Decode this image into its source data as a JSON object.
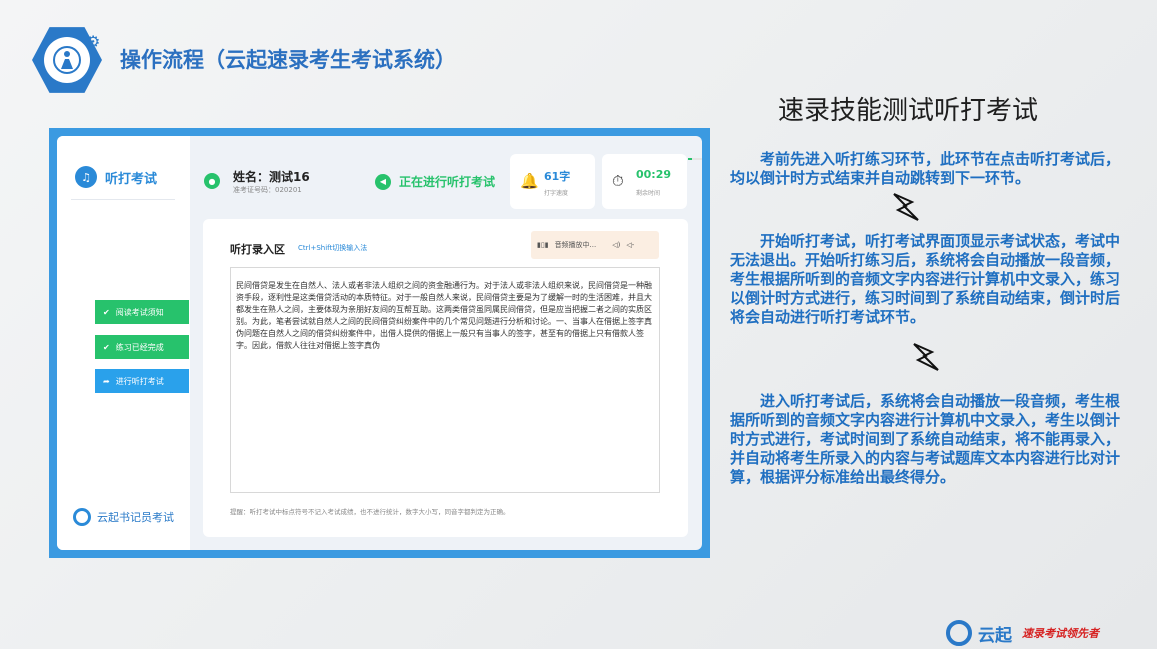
{
  "header": {
    "title": "操作流程（云起速录考生考试系统）"
  },
  "section": {
    "title": "速录技能测试听打考试",
    "paragraphs": [
      "　　考前先进入听打练习环节，此环节在点击听打考试后，均以倒计时方式结束并自动跳转到下一环节。",
      "　　开始听打考试，听打考试界面顶显示考试状态，考试中无法退出。开始听打练习后，系统将会自动播放一段音频，考生根据所听到的音频文字内容进行计算机中文录入，练习以倒计时方式进行，练习时间到了系统自动结束，倒计时后将会自动进行听打考试环节。",
      "　　进入听打考试后，系统将会自动播放一段音频，考生根据所听到的音频文字内容进行计算机中文录入，考生以倒计时方式进行，考试时间到了系统自动结束，将不能再录入，并自动将考生所录入的内容与考试题库文本内容进行比对计算，根据评分标准给出最终得分。"
    ]
  },
  "app": {
    "sidebar": {
      "title": "听打考试",
      "buttons": [
        "阅读考试须知",
        "练习已经完成",
        "进行听打考试"
      ],
      "brand": "云起书记员考试"
    },
    "user": {
      "name": "姓名：测试16",
      "exam_no": "准考证号码：020201"
    },
    "status": "正在进行听打考试",
    "speed": {
      "value": "61字",
      "label": "打字速度"
    },
    "timer": {
      "value": "00:29",
      "label": "剩余时间"
    },
    "main": {
      "title": "听打录入区",
      "hint": "Ctrl+Shift切换输入法",
      "audio_label": "音频播放中...",
      "text": "民间借贷是发生在自然人、法人或者非法人组织之间的资金融通行为。对于法人或非法人组织来说，民间借贷是一种融资手段，逐利性是这类借贷活动的本质特征。对于一般自然人来说，民间借贷主要是为了缓解一时的生活困难，并且大都发生在熟人之间，主要体现为亲朋好友间的互帮互助。这两类借贷虽同属民间借贷，但是应当把握二者之间的实质区别。为此，笔者尝试就自然人之间的民间借贷纠纷案件中的几个常见问题进行分析和讨论。一、当事人在借据上签字真伪问题在自然人之间的借贷纠纷案件中，出借人提供的借据上一般只有当事人的签字，甚至有的借据上只有借款人签字。因此，借款人往往对借据上签字真伪",
      "tip": "提醒：听打考试中标点符号不记入考试成绩，也不进行统计，数字大小写，同音字都判定为正确。"
    }
  },
  "footer": {
    "brand": "云起",
    "slogan": "速录考试领先者"
  }
}
